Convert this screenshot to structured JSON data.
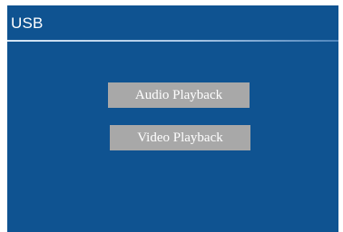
{
  "header": {
    "title": "USB"
  },
  "menu": {
    "items": [
      {
        "label": "Audio Playback"
      },
      {
        "label": "Video Playback"
      }
    ]
  },
  "colors": {
    "background": "#0f5391",
    "button": "#a8a8a8",
    "text": "#ffffff"
  }
}
